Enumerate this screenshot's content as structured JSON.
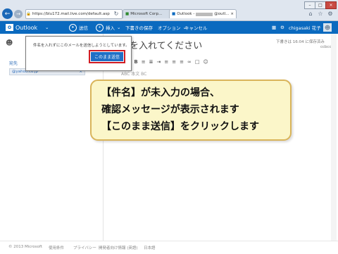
{
  "browser": {
    "address": "https://blu172.mail.live.com/default.asp",
    "tabs": [
      {
        "label": "Microsoft Corp..."
      },
      {
        "label": "Outlook - ",
        "extra": "@outl..."
      }
    ]
  },
  "outlook": {
    "logo_text": "Outlook",
    "send_label": "送信",
    "insert_label": "挿入",
    "save_draft_label": "下書きの保存",
    "options_label": "オプション",
    "cancel_label": "キャンセル",
    "user_name": "chigasaki 花子"
  },
  "compose": {
    "to_label": "宛先",
    "recipient": "@yahoo.co.jp",
    "subject": "を入れてください",
    "draft_saved": "下書きは 16:04 に保存済み",
    "cc_label": "ccbcc",
    "body_preview": "ABC  本文  BC"
  },
  "popup": {
    "message": "件名を入れずにこのメールを送信しようとしています。",
    "send_anyway": "このまま送信"
  },
  "callout": {
    "line1": "【件名】が未入力の場合、",
    "line2": "確認メッセージが表示されます",
    "line3": "【このまま送信】をクリックします"
  },
  "footer": {
    "copyright": "© 2013 Microsoft",
    "terms": "使用条件",
    "privacy": "プライバシー",
    "developers": "開発者向け情報 (英語)",
    "language": "日本語"
  }
}
